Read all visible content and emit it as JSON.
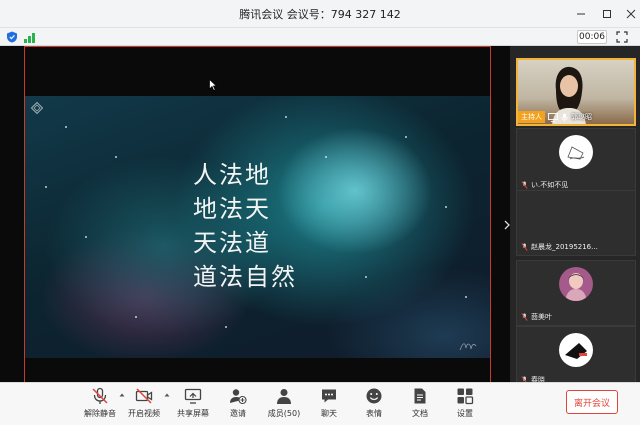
{
  "window": {
    "title": "腾讯会议 会议号：794 327 142",
    "timer": "00:06"
  },
  "slide": {
    "lines": [
      "人法地",
      "地法天",
      "天法道",
      "道法自然"
    ]
  },
  "participants": {
    "host_badge": "主持人",
    "host_name": "郭璐昭",
    "tiles": [
      {
        "name": "い.不如不见"
      },
      {
        "name": "赵晨龙_20195216..."
      },
      {
        "name": "茴美叶"
      },
      {
        "name": "春晓"
      }
    ]
  },
  "toolbar": {
    "items": [
      {
        "label": "解除静音"
      },
      {
        "label": "开启视频"
      },
      {
        "label": "共享屏幕"
      },
      {
        "label": "邀请"
      },
      {
        "label": "成员(50)"
      },
      {
        "label": "聊天"
      },
      {
        "label": "表情"
      },
      {
        "label": "文档"
      },
      {
        "label": "设置"
      }
    ],
    "end_label": "离开会议"
  },
  "colors": {
    "accent_red": "#e0453a",
    "host_badge": "#f3a21f",
    "share_border": "#c83a2a"
  },
  "icons": [
    "shield-icon",
    "signal-icon",
    "fullscreen-icon",
    "mic-muted-icon",
    "video-off-icon",
    "share-screen-icon",
    "invite-icon",
    "members-icon",
    "chat-icon",
    "emoji-icon",
    "document-icon",
    "settings-icon"
  ]
}
